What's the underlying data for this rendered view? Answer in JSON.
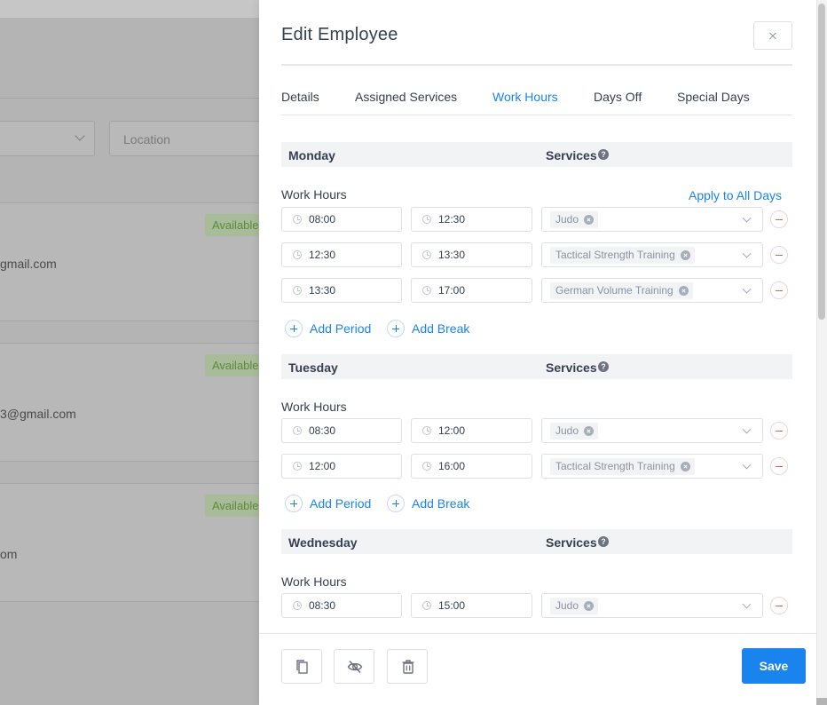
{
  "background": {
    "location_placeholder": "Location",
    "employees": [
      {
        "status": "Available",
        "email": "gmail.com"
      },
      {
        "status": "Available",
        "email": "3@gmail.com"
      },
      {
        "status": "Available",
        "email": "om"
      }
    ]
  },
  "drawer": {
    "title": "Edit Employee",
    "tabs": [
      "Details",
      "Assigned Services",
      "Work Hours",
      "Days Off",
      "Special Days"
    ],
    "active_tab": "Work Hours",
    "services_label": "Services",
    "work_hours_label": "Work Hours",
    "apply_all": "Apply to All Days",
    "add_period": "Add Period",
    "add_break": "Add Break",
    "days": [
      {
        "name": "Monday",
        "periods": [
          {
            "start": "08:00",
            "end": "12:30",
            "service": "Judo"
          },
          {
            "start": "12:30",
            "end": "13:30",
            "service": "Tactical Strength Training"
          },
          {
            "start": "13:30",
            "end": "17:00",
            "service": "German Volume Training"
          }
        ]
      },
      {
        "name": "Tuesday",
        "periods": [
          {
            "start": "08:30",
            "end": "12:00",
            "service": "Judo"
          },
          {
            "start": "12:00",
            "end": "16:00",
            "service": "Tactical Strength Training"
          }
        ]
      },
      {
        "name": "Wednesday",
        "periods": [
          {
            "start": "08:30",
            "end": "15:00",
            "service": "Judo"
          }
        ]
      }
    ],
    "footer": {
      "save_label": "Save",
      "icons": [
        "copy-icon",
        "eye-off-icon",
        "trash-icon"
      ]
    }
  },
  "colors": {
    "accent": "#1a84ee",
    "danger": "#e05d5d",
    "text": "#354052",
    "available_badge": "#5c8a3d"
  }
}
